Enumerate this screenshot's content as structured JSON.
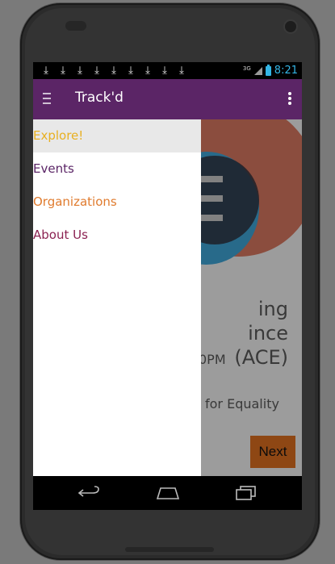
{
  "statusbar": {
    "download_icons": [
      "download-icon",
      "download-icon",
      "download-icon",
      "download-icon",
      "download-icon",
      "download-icon",
      "download-icon",
      "download-icon",
      "download-icon"
    ],
    "network": "3G",
    "time": "8:21",
    "accent": "#33b5e5"
  },
  "appbar": {
    "title": "Track'd",
    "color": "#5b2566"
  },
  "drawer": {
    "items": [
      {
        "label": "Explore!",
        "color": "#e8b021",
        "active": true
      },
      {
        "label": "Events",
        "color": "#5b2566",
        "active": false
      },
      {
        "label": "Organizations",
        "color": "#e07b2e",
        "active": false
      },
      {
        "label": "About Us",
        "color": "#8b2252",
        "active": false
      }
    ]
  },
  "content": {
    "event_name": "ing ince (ACE)",
    "event_time": "0PM",
    "event_org": "for Equality",
    "next_label": "Next"
  },
  "navbar": {
    "icons": [
      "back-icon",
      "home-icon",
      "recent-apps-icon"
    ]
  }
}
